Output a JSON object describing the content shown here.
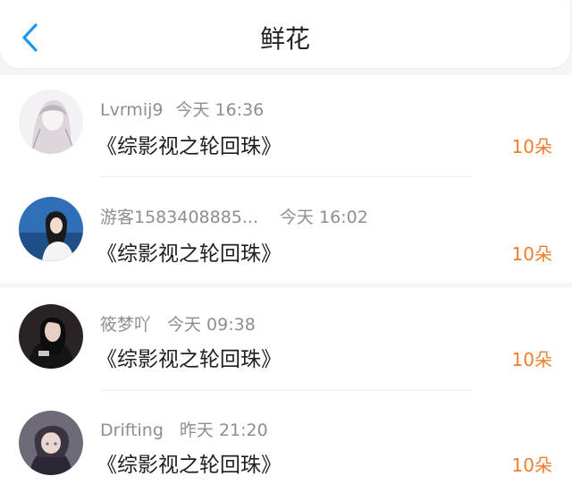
{
  "header": {
    "back_icon": "chevron-left-icon",
    "title": "鲜花"
  },
  "colors": {
    "accent_blue": "#1a9bf0",
    "amount_orange": "#f07d2c",
    "meta_gray": "#8e8e8e"
  },
  "items": [
    {
      "user": "Lvrmij9",
      "time": "今天 16:36",
      "book": "《综影视之轮回珠》",
      "amount": "10朵"
    },
    {
      "user": "游客1583408885...",
      "time": "今天 16:02",
      "book": "《综影视之轮回珠》",
      "amount": "10朵"
    },
    {
      "user": "筱梦吖",
      "time": "今天 09:38",
      "book": "《综影视之轮回珠》",
      "amount": "10朵"
    },
    {
      "user": "Drifting",
      "time": "昨天 21:20",
      "book": "《综影视之轮回珠》",
      "amount": "10朵"
    }
  ]
}
